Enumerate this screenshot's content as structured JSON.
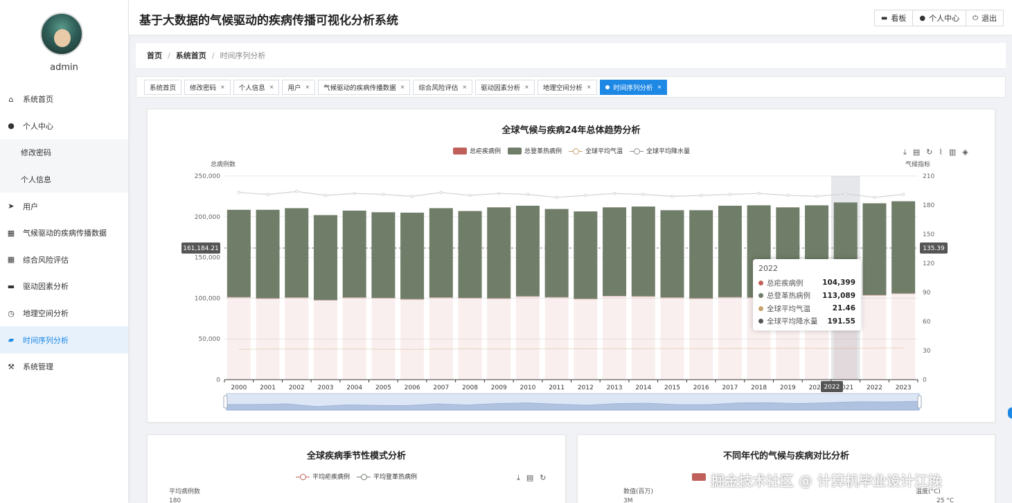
{
  "sidebar": {
    "username": "admin",
    "items": [
      {
        "label": "系统首页",
        "icon": "home-icon",
        "glyph": "⌂",
        "type": "main"
      },
      {
        "label": "个人中心",
        "icon": "user-icon",
        "glyph": "●",
        "type": "main"
      },
      {
        "label": "修改密码",
        "icon": "",
        "glyph": "",
        "type": "sub"
      },
      {
        "label": "个人信息",
        "icon": "",
        "glyph": "",
        "type": "sub"
      },
      {
        "label": "用户",
        "icon": "send-icon",
        "glyph": "➤",
        "type": "main"
      },
      {
        "label": "气候驱动的疾病传播数据",
        "icon": "grid-icon",
        "glyph": "▦",
        "type": "main"
      },
      {
        "label": "综合风险评估",
        "icon": "table-icon",
        "glyph": "▦",
        "type": "main"
      },
      {
        "label": "驱动因素分析",
        "icon": "briefcase-icon",
        "glyph": "▬",
        "type": "main"
      },
      {
        "label": "地理空间分析",
        "icon": "compass-icon",
        "glyph": "◷",
        "type": "main"
      },
      {
        "label": "时间序列分析",
        "icon": "chat-icon",
        "glyph": "▰",
        "type": "active"
      },
      {
        "label": "系统管理",
        "icon": "tools-icon",
        "glyph": "⚒",
        "type": "main"
      }
    ]
  },
  "header": {
    "title": "基于大数据的气候驱动的疾病传播可视化分析系统",
    "buttons": [
      {
        "label": "看板",
        "icon": "monitor-icon",
        "glyph": "▬"
      },
      {
        "label": "个人中心",
        "icon": "user-icon",
        "glyph": "●"
      },
      {
        "label": "退出",
        "icon": "power-icon",
        "glyph": "⏻"
      }
    ]
  },
  "breadcrumb": {
    "home": "首页",
    "section": "系统首页",
    "current": "时间序列分析"
  },
  "tabs": [
    {
      "label": "系统首页",
      "closable": false,
      "active": false
    },
    {
      "label": "修改密码",
      "closable": true,
      "active": false
    },
    {
      "label": "个人信息",
      "closable": true,
      "active": false
    },
    {
      "label": "用户",
      "closable": true,
      "active": false
    },
    {
      "label": "气候驱动的疾病传播数据",
      "closable": true,
      "active": false
    },
    {
      "label": "综合风险评估",
      "closable": true,
      "active": false
    },
    {
      "label": "驱动因素分析",
      "closable": true,
      "active": false
    },
    {
      "label": "地理空间分析",
      "closable": true,
      "active": false
    },
    {
      "label": "时间序列分析",
      "closable": true,
      "active": true
    }
  ],
  "chart_data": [
    {
      "type": "bar",
      "title": "全球气候与疾病24年总体趋势分析",
      "ylabel": "总病例数",
      "y2label": "气候指标",
      "ylim": [
        0,
        250000
      ],
      "y2lim": [
        0,
        210
      ],
      "yticks": [
        "0",
        "50,000",
        "100,000",
        "150,000",
        "200,000",
        "250,000"
      ],
      "y2ticks": [
        "0",
        "30",
        "60",
        "90",
        "120",
        "150",
        "180",
        "210"
      ],
      "categories": [
        "2000",
        "2001",
        "2002",
        "2003",
        "2004",
        "2005",
        "2006",
        "2007",
        "2008",
        "2009",
        "2010",
        "2011",
        "2012",
        "2013",
        "2014",
        "2015",
        "2016",
        "2017",
        "2018",
        "2019",
        "2020",
        "2021",
        "2022",
        "2023"
      ],
      "series": [
        {
          "name": "总疟疾病例",
          "type": "bar-stack",
          "color": "#c0605a",
          "values": [
            101000,
            99500,
            100500,
            97500,
            100500,
            100000,
            98500,
            100500,
            100000,
            99500,
            102000,
            101000,
            99000,
            102500,
            102000,
            100500,
            99500,
            101000,
            100500,
            101500,
            103000,
            104399,
            103500,
            105500
          ]
        },
        {
          "name": "总登革热病例",
          "type": "bar-stack",
          "color": "#707d69",
          "values": [
            107500,
            109000,
            110000,
            104500,
            107000,
            105500,
            106500,
            110000,
            107000,
            112000,
            111500,
            108500,
            107500,
            109000,
            110500,
            107500,
            108500,
            112500,
            113500,
            110000,
            111000,
            113089,
            113000,
            113500
          ]
        },
        {
          "name": "全球平均气温",
          "type": "line",
          "color": "#c9a06a",
          "values": [
            20.9,
            21.0,
            21.1,
            21.0,
            21.1,
            20.9,
            20.8,
            21.1,
            21.2,
            21.0,
            21.1,
            21.3,
            21.2,
            21.3,
            21.2,
            21.4,
            21.3,
            21.5,
            21.4,
            21.6,
            21.5,
            21.46,
            21.7,
            21.8
          ]
        },
        {
          "name": "全球平均降水量",
          "type": "line",
          "color": "#8a8e92",
          "values": [
            193,
            191,
            194,
            190,
            192,
            191,
            189,
            193,
            190,
            192,
            191,
            188,
            190,
            192,
            191,
            189,
            190,
            191,
            192,
            190,
            189,
            191.55,
            188,
            191
          ]
        }
      ],
      "crosshair": {
        "y_value": "161,184.21",
        "y2_value": "135.39",
        "x_value": "2022"
      },
      "legend_position": "top",
      "grid": true
    },
    {
      "type": "line",
      "title": "全球疾病季节性模式分析",
      "ylabel": "平均病例数",
      "yticks": [
        "180"
      ],
      "series": [
        {
          "name": "平均疟疾病例",
          "color": "#c0605a"
        },
        {
          "name": "平均登革热病例",
          "color": "#707d69"
        }
      ],
      "legend_position": "top"
    },
    {
      "type": "bar",
      "title": "不同年代的气候与疾病对比分析",
      "ylabel": "数值(百万)",
      "y2label": "温度(°C)",
      "yticks": [
        "3M"
      ],
      "y2ticks": [
        "25 °C"
      ],
      "series": [
        {
          "name": "",
          "color": "#c0605a"
        }
      ],
      "legend_position": "top"
    }
  ],
  "tooltip": {
    "title": "2022",
    "rows": [
      {
        "name": "总疟疾病例",
        "value": "104,399",
        "color": "#c0605a"
      },
      {
        "name": "总登革热病例",
        "value": "113,089",
        "color": "#707d69"
      },
      {
        "name": "全球平均气温",
        "value": "21.46",
        "color": "#c9a06a"
      },
      {
        "name": "全球平均降水量",
        "value": "191.55",
        "color": "#555555"
      }
    ]
  },
  "watermark": "掘金技术社区 @ 计算机毕业设计江挽",
  "colors": {
    "accent": "#1e88e5",
    "malaria": "#c0605a",
    "dengue": "#707d69"
  }
}
